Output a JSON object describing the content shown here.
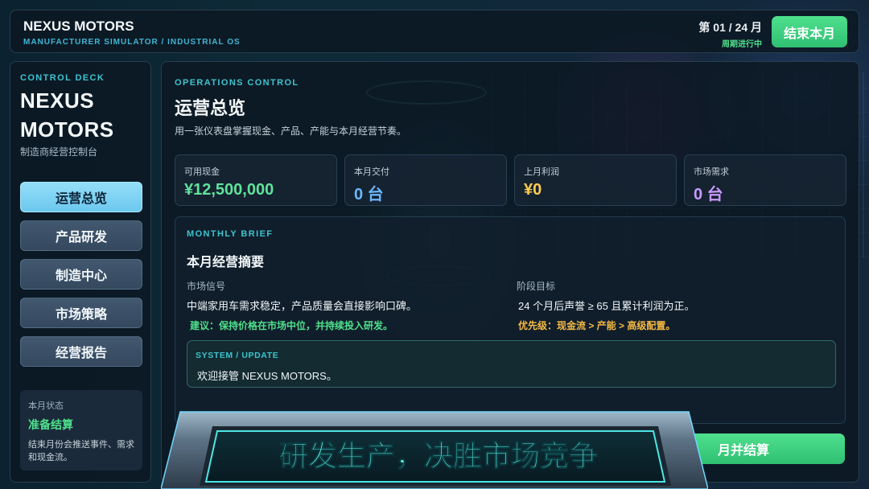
{
  "app": {
    "title": "NEXUS MOTORS",
    "subtitle": "MANUFACTURER SIMULATOR / INDUSTRIAL OS"
  },
  "period": {
    "label": "第 01 / 24 月",
    "status": "周期进行中",
    "end_button": "结束本月"
  },
  "sidebar": {
    "kicker": "CONTROL DECK",
    "brand_line1": "NEXUS",
    "brand_line2": "MOTORS",
    "brand_sub": "制造商经营控制台",
    "items": [
      {
        "label": "运营总览",
        "active": true
      },
      {
        "label": "产品研发",
        "active": false
      },
      {
        "label": "制造中心",
        "active": false
      },
      {
        "label": "市场策略",
        "active": false
      },
      {
        "label": "经营报告",
        "active": false
      }
    ],
    "status": {
      "title": "本月状态",
      "value": "准备结算",
      "desc": "结束月份会推送事件、需求和现金流。"
    }
  },
  "main": {
    "kicker": "OPERATIONS CONTROL",
    "title": "运营总览",
    "desc": "用一张仪表盘掌握现金、产品、产能与本月经营节奏。",
    "stats": [
      {
        "label": "可用现金",
        "value": "¥12,500,000",
        "color": "#5fe39a"
      },
      {
        "label": "本月交付",
        "value": "0 台",
        "color": "#6ab8ff"
      },
      {
        "label": "上月利润",
        "value": "¥0",
        "color": "#ffcc4d"
      },
      {
        "label": "市场需求",
        "value": "0 台",
        "color": "#c89bff"
      }
    ],
    "brief": {
      "kicker": "MONTHLY BRIEF",
      "title": "本月经营摘要",
      "left": {
        "label": "市场信号",
        "text": "中端家用车需求稳定，产品质量会直接影响口碑。",
        "hint": "建议：保持价格在市场中位，并持续投入研发。",
        "hint_color": "#4ee08c"
      },
      "right": {
        "label": "阶段目标",
        "text": "24 个月后声誉 ≥ 65 且累计利润为正。",
        "hint": "优先级：现金流 > 产能 > 高级配置。",
        "hint_color": "#f5b942"
      }
    },
    "system": {
      "kicker": "SYSTEM / UPDATE",
      "text": "欢迎接管 NEXUS MOTORS。"
    },
    "settle_button": "月并结算"
  },
  "banner": {
    "text": "研发生产，决胜市场竞争"
  },
  "colors": {
    "accent_teal": "#3cc4cf",
    "button_green": "#3ad27e",
    "nav_active": "#7fd4f5",
    "banner_text": "#5ff2e8"
  }
}
